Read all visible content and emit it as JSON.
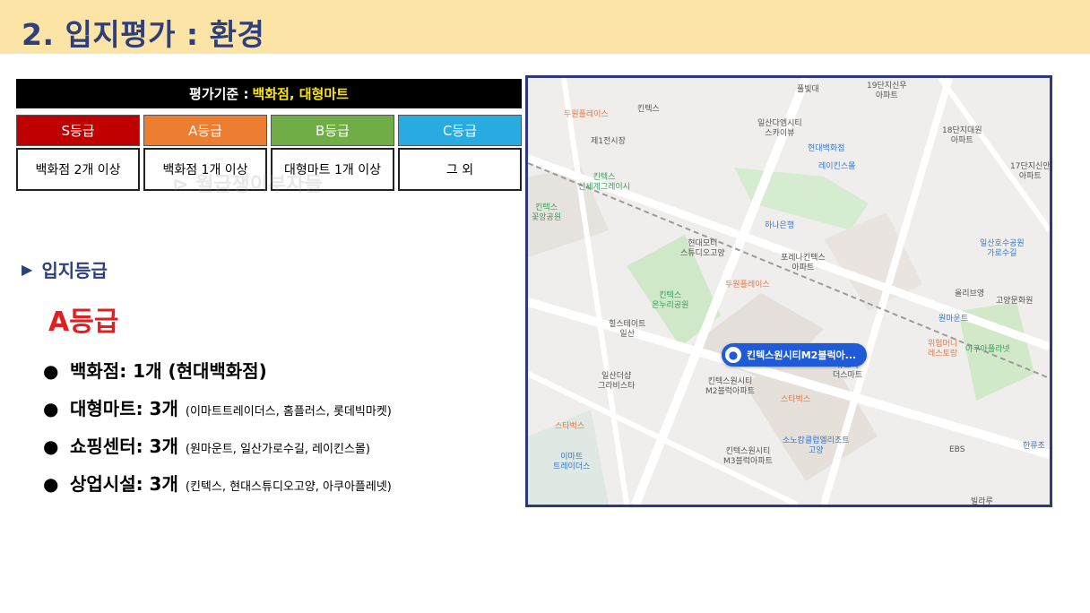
{
  "title": "2. 입지평가 : 환경",
  "criteria": {
    "prefix": "평가기준 :",
    "highlight": "백화점, 대형마트"
  },
  "grades": [
    {
      "label": "S등급",
      "desc": "백화점 2개 이상",
      "color": "#c00000"
    },
    {
      "label": "A등급",
      "desc": "백화점 1개 이상",
      "color": "#ed7d31"
    },
    {
      "label": "B등급",
      "desc": "대형마트 1개 이상",
      "color": "#70ad47"
    },
    {
      "label": "C등급",
      "desc": "그 외",
      "color": "#29abe2"
    }
  ],
  "watermark": "⊳ 월급쟁이부자들",
  "section": {
    "marker": "▶",
    "title": "입지등급",
    "grade": "A등급"
  },
  "bullets": [
    {
      "main": "백화점: 1개 (현대백화점)",
      "small": ""
    },
    {
      "main": "대형마트: 3개",
      "small": "(이마트트레이더스, 홈플러스, 롯데빅마켓)"
    },
    {
      "main": "쇼핑센터: 3개",
      "small": "(원마운트, 일산가로수길, 레이킨스몰)"
    },
    {
      "main": "상업시설: 3개",
      "small": "(킨텍스, 현대스튜디오고양, 아쿠아플레넷)"
    }
  ],
  "map": {
    "pin_label": "킨텍스원시티M2블럭아...",
    "labels": {
      "l1": "풀빛대",
      "l2": "19단지신우\n아파트",
      "l3": "두원플레이스",
      "l4": "킨텍스",
      "l5": "일산다엠시티\n스카이뷰",
      "l6": "18단지대원\n아파트",
      "l7": "제1전시장",
      "l8": "현대백화점",
      "l9": "레이킨스몰",
      "l10": "17단지신안\n아파트",
      "l11": "킨텍스\n신세계그레이시",
      "l12": "킨텍스\n꽃앙공원",
      "l13": "하나은행",
      "l14": "현대모터\n스튜디오고양",
      "l15": "포레나킨텍스\n아파트",
      "l16": "일산호수공원\n가로수길",
      "l17": "두원플레이스",
      "l18": "킨텍스\n온누리공원",
      "l19": "올리브영",
      "l20": "고양문화원",
      "l21": "힐스테이트\n일산",
      "l22": "원마운트",
      "l23": "위험머니\n레스토랑",
      "l24": "아쿠아플라넷",
      "l25": "일산더샵\n그라비스타",
      "l26": "킨텍스원시티\nM2블럭아파트",
      "l27": "유보라\n더스마트",
      "l28": "스타벅스",
      "l29": "스타벅스",
      "l30": "이마트\n트레이더스",
      "l31": "소노캄클럽엘리조트\n고양",
      "l32": "킨텍스원시티\nM3블럭아파트",
      "l33": "EBS",
      "l34": "한류조",
      "l35": "빌라루"
    }
  }
}
